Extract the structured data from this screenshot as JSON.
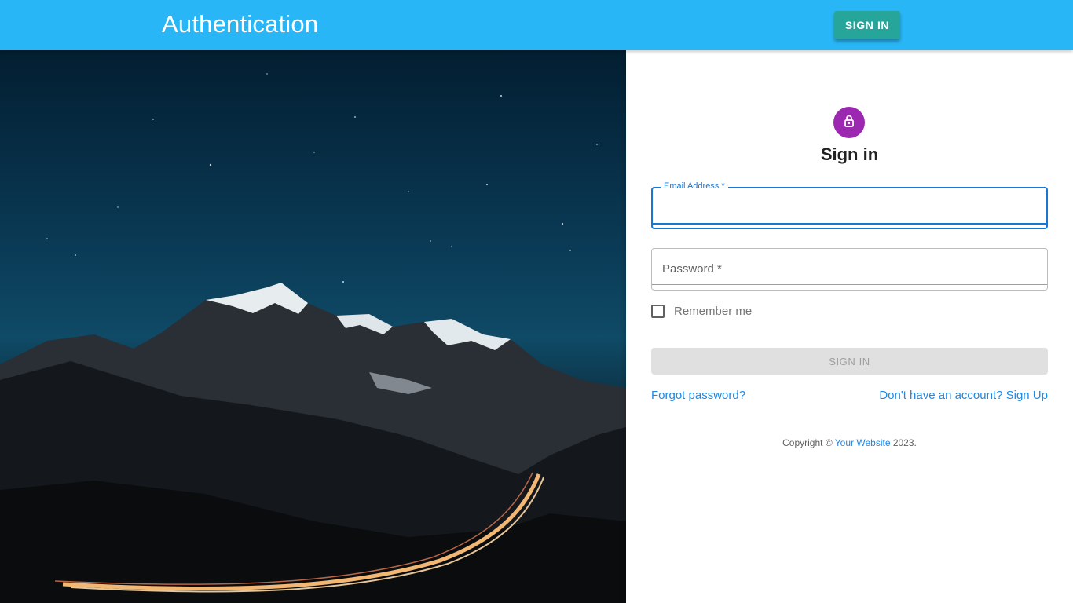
{
  "appbar": {
    "title": "Authentication",
    "sign_in_label": "SIGN IN",
    "color": "#29b6f6",
    "button_color": "#26a69a"
  },
  "hero": {
    "image": "night mountain landscape with light-trail road",
    "icon": "landscape-photo"
  },
  "form": {
    "icon": "lock-icon",
    "icon_color": "#9c27b0",
    "heading": "Sign in",
    "email_label": "Email Address *",
    "password_label": "Password *",
    "remember_label": "Remember me",
    "submit_label": "SIGN IN",
    "forgot_link": "Forgot password?",
    "signup_link": "Don't have an account? Sign Up",
    "focus_color": "#1976d2",
    "link_color": "#1e88e5"
  },
  "footer": {
    "prefix": "Copyright © ",
    "site_link": "Your Website",
    "suffix": " 2023."
  }
}
